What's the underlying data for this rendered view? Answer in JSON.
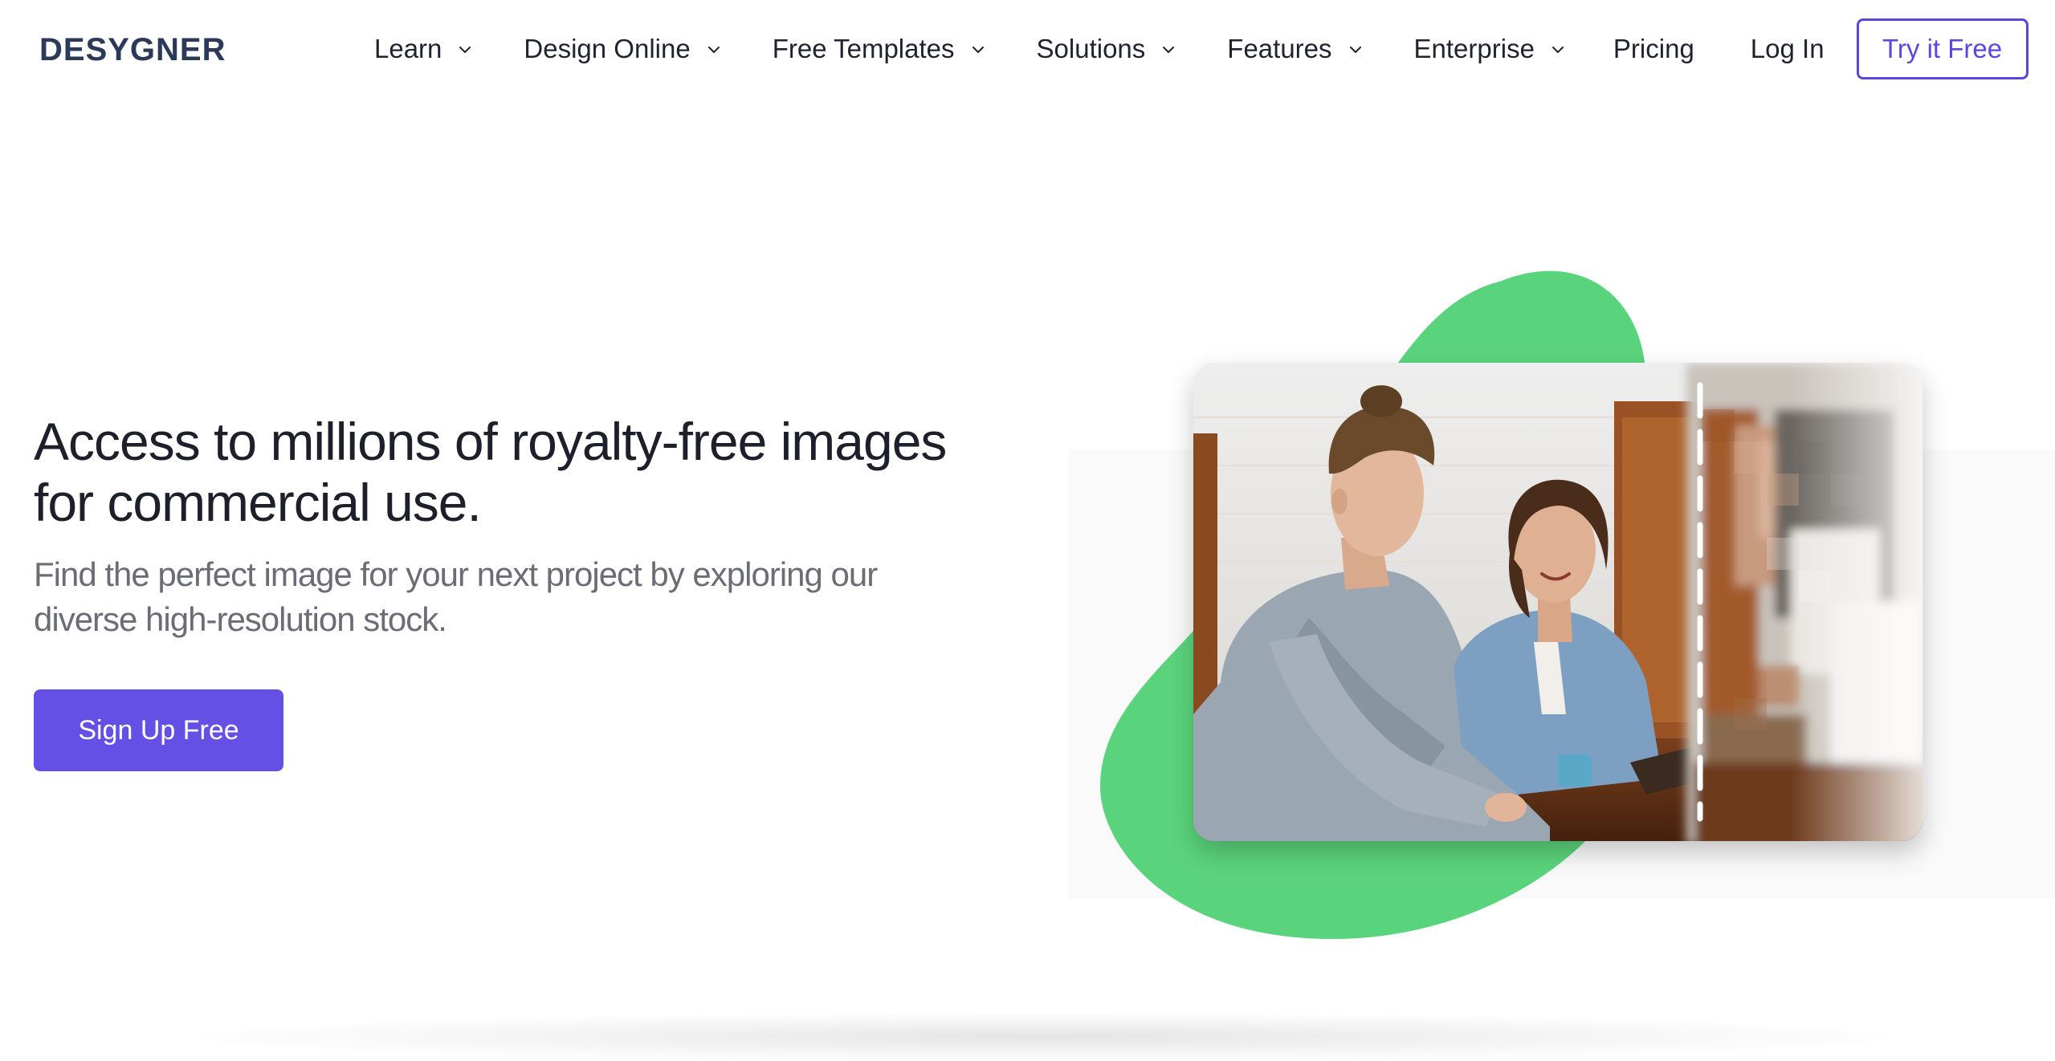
{
  "brand": {
    "logo_text": "DESYGNER",
    "accent_color": "#5b46e0",
    "blob_color": "#5ad47c"
  },
  "nav": {
    "items": [
      {
        "label": "Learn",
        "icon": "chevron-down-icon"
      },
      {
        "label": "Design Online",
        "icon": "chevron-down-icon"
      },
      {
        "label": "Free Templates",
        "icon": "chevron-down-icon"
      },
      {
        "label": "Solutions",
        "icon": "chevron-down-icon"
      },
      {
        "label": "Features",
        "icon": "chevron-down-icon"
      },
      {
        "label": "Enterprise",
        "icon": "chevron-down-icon"
      },
      {
        "label": "Pricing"
      },
      {
        "label": "Log In"
      }
    ],
    "cta_label": "Try it Free"
  },
  "hero": {
    "title": "Access to millions of royalty-free images for commercial use.",
    "subtitle": "Find the perfect image for your next project by exploring our diverse high-resolution stock.",
    "cta_label": "Sign Up Free",
    "illustration": "stock-photo-comparison-crisp-vs-pixelated"
  }
}
